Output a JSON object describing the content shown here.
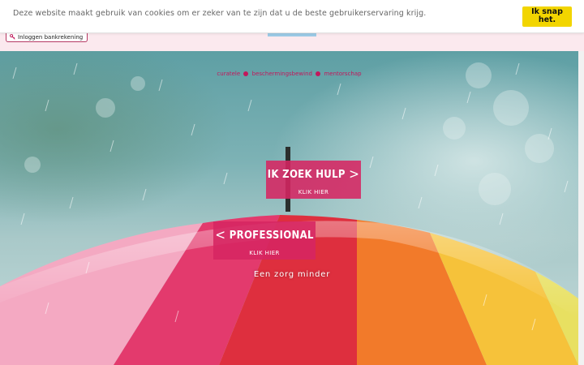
{
  "cookie": {
    "message": "Deze website maakt gebruik van cookies om er zeker van te zijn dat u de beste gebruikerservaring krijg.",
    "button_label": "Ik snap\nhet."
  },
  "header": {
    "login_label": "Inloggen bankrekening",
    "login_icon": "key-icon"
  },
  "hero": {
    "tagline": [
      "curatele",
      "beschermingsbewind",
      "mentorschap"
    ],
    "cta_help": {
      "title": "IK ZOEK HULP",
      "arrow": ">",
      "subtitle": "KLIK HIER"
    },
    "cta_professional": {
      "title": "PROFESSIONAL",
      "arrow": "<",
      "subtitle": "KLIK HIER"
    },
    "motto": "Een zorg minder"
  },
  "colors": {
    "accent": "#d62662",
    "cookie_button": "#f2d500",
    "page_background": "#fbe9ee"
  }
}
